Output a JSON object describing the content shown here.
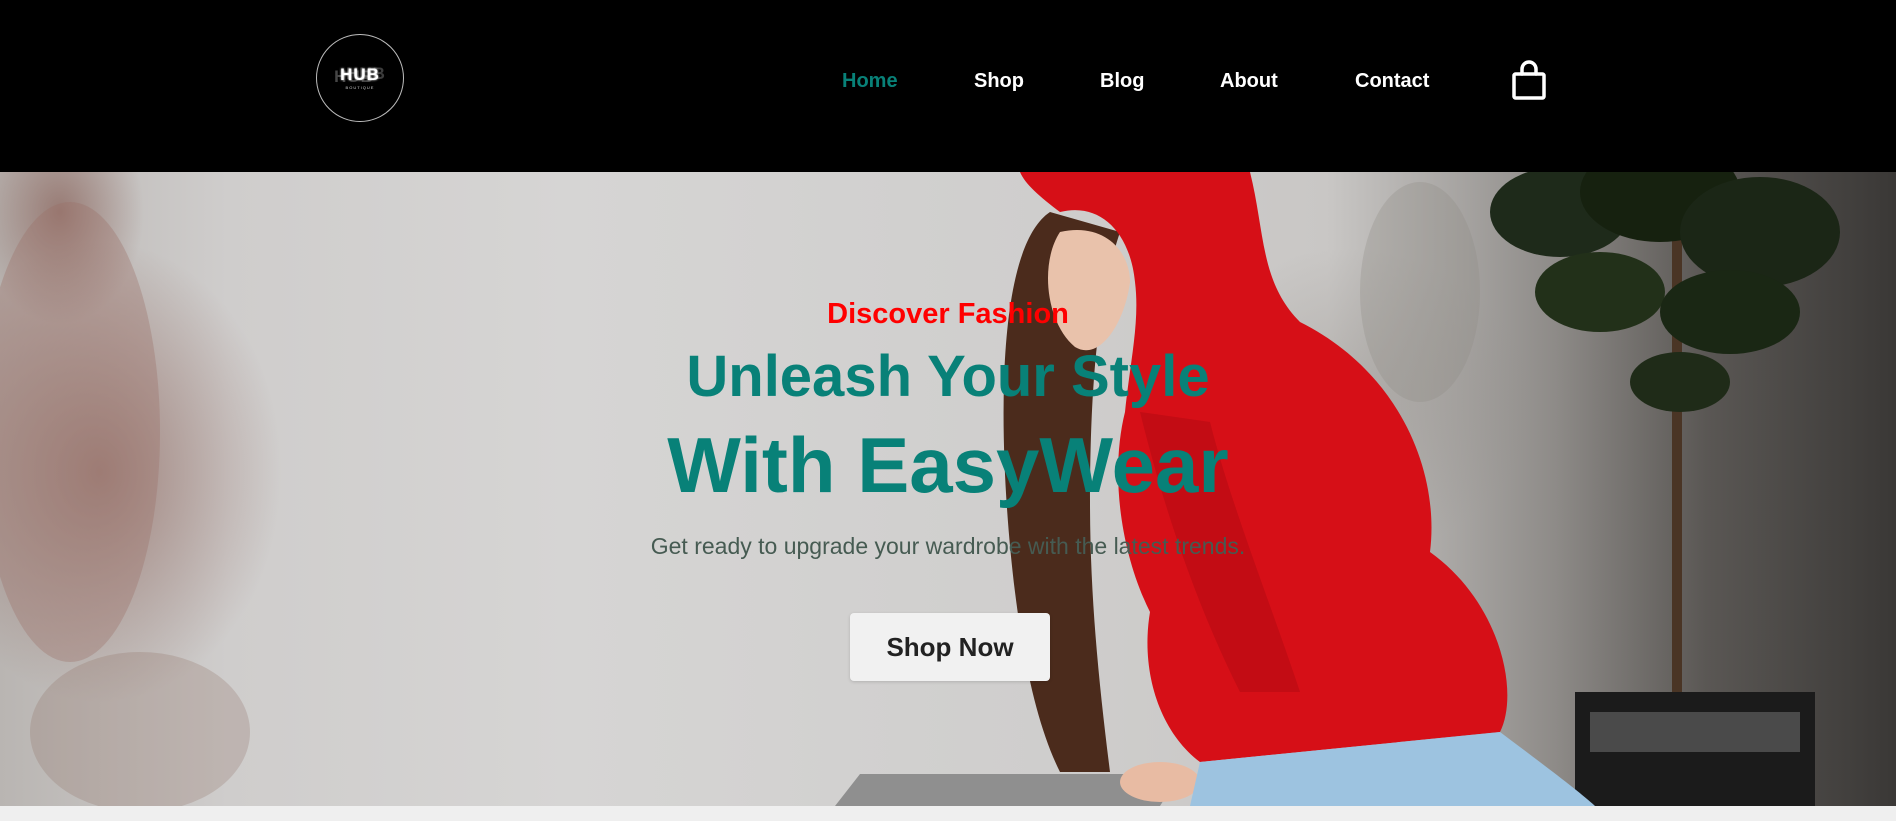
{
  "header": {
    "logo": {
      "text": "HUB",
      "subtext": "BOUTIQUE"
    },
    "nav": [
      {
        "label": "Home",
        "active": true
      },
      {
        "label": "Shop",
        "active": false
      },
      {
        "label": "Blog",
        "active": false
      },
      {
        "label": "About",
        "active": false
      },
      {
        "label": "Contact",
        "active": false
      }
    ],
    "cart_icon": "shopping-bag-icon"
  },
  "hero": {
    "eyebrow": "Discover Fashion",
    "headline_line1": "Unleash Your Style",
    "headline_line2": "With EasyWear",
    "subtext": "Get ready to upgrade your wardrobe with the latest trends.",
    "cta_label": "Shop Now",
    "image_description": "model-in-red-hoodie"
  },
  "colors": {
    "brand": "#088178",
    "accent": "#ff0000",
    "header_bg": "#000000",
    "nav_text": "#ffffff",
    "cta_bg": "#f1f1f1"
  }
}
